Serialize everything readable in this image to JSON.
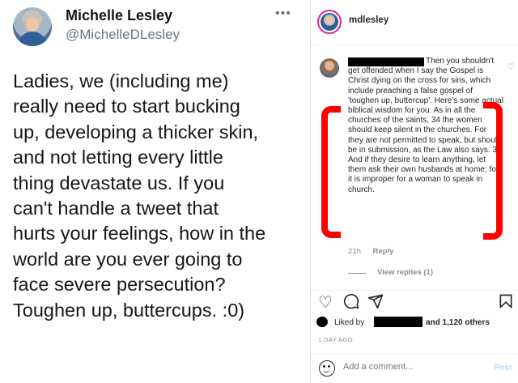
{
  "tweet": {
    "name": "Michelle Lesley",
    "handle": "@MichelleDLesley",
    "more_label": "•••",
    "text": "Ladies, we (including me)\nreally need to start bucking\nup, developing a thicker skin,\nand not letting every little\nthing devastate us. If you\ncan't handle a tweet that\nhurts your feelings, how in the\nworld are you ever going to\nface severe persecution?\nToughen up, buttercups. :0)"
  },
  "instagram": {
    "username": "mdlesley",
    "comment": {
      "text": "Then you shouldn't get offended when I say the Gospel is Christ dying on the cross for sins, which include preaching a false gospel of 'toughen up, buttercup'. Here's some actual biblical wisdom for you.  As in all the churches of the saints, 34 the women should keep silent in the churches. For they are not permitted to speak, but should be in submission, as the Law also says. 35 And if they desire to learn anything, let them ask their own husbands at home; for it is improper for a woman to speak in church.",
      "time": "21h",
      "reply_label": "Reply",
      "view_replies": "View replies (1)",
      "heart_icon": "heart-outline-icon"
    },
    "actions": {
      "like_icon": "heart-icon",
      "comment_icon": "comment-icon",
      "share_icon": "paper-plane-icon",
      "save_icon": "bookmark-icon"
    },
    "likes": {
      "prefix": "Liked by",
      "suffix": "and 1,120 others"
    },
    "timestamp": "1 DAY AGO",
    "add_comment": {
      "placeholder": "Add a comment...",
      "post_label": "Post"
    }
  },
  "colors": {
    "annotation_red": "#ff0000",
    "post_blue": "#b2dffc",
    "handle_gray": "#657786"
  }
}
